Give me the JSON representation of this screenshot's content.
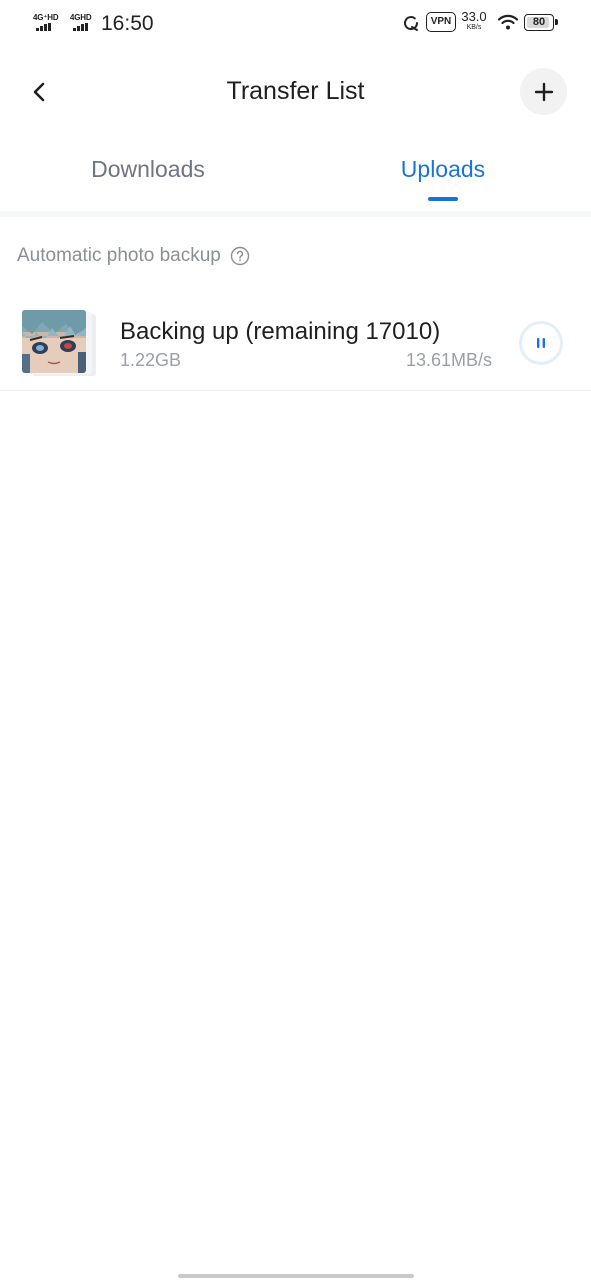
{
  "status_bar": {
    "sim1_network": "4G⁺HD",
    "sim2_network": "4GHD",
    "time": "16:50",
    "vpn_label": "VPN",
    "net_speed": "33.0",
    "net_speed_unit": "KB/s",
    "battery": "80"
  },
  "header": {
    "title": "Transfer List",
    "back_icon": "chevron-left-icon",
    "add_icon": "plus-icon"
  },
  "tabs": [
    {
      "label": "Downloads",
      "active": false
    },
    {
      "label": "Uploads",
      "active": true
    }
  ],
  "section": {
    "label": "Automatic photo backup",
    "help_icon": "question-circle-icon"
  },
  "backup_item": {
    "title": "Backing up (remaining 17010)",
    "size": "1.22GB",
    "speed": "13.61MB/s",
    "action_icon": "pause-icon"
  },
  "colors": {
    "accent": "#1a73d9",
    "muted_text": "#9aa0a6",
    "tab_inactive": "#6f7580"
  }
}
